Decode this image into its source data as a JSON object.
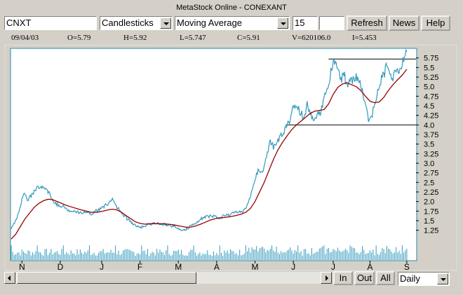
{
  "window": {
    "title": "MetaStock Online - CONEXANT"
  },
  "toolbar": {
    "symbol": "CNXT",
    "chart_style": "Candlesticks",
    "indicator": "Moving Average",
    "period": "15",
    "refresh_label": "Refresh",
    "news_label": "News",
    "help_label": "Help"
  },
  "quote": {
    "date": "09/04/03",
    "open": "O=5.79",
    "high": "H=5.92",
    "low": "L=5.747",
    "close": "C=5.91",
    "volume": "V=620106.0",
    "indicator_value": "I=5.453"
  },
  "bottom": {
    "zoom_in_label": "In",
    "zoom_out_label": "Out",
    "all_label": "All",
    "interval": "Daily"
  },
  "colors": {
    "price": "#3399bb",
    "moving_average": "#990000",
    "volume": "#3399bb",
    "chart_background": "#ffffff",
    "frame": "#2a8aa8"
  },
  "icons": {
    "scroll_left": "scroll-left-arrow-icon",
    "scroll_right": "scroll-right-arrow-icon",
    "dropdown": "chevron-down-icon"
  },
  "chart_data": {
    "type": "line",
    "symbol": "CNXT",
    "interval": "Daily",
    "y_ticks": [
      "5.75",
      "5.5",
      "5.25",
      "5.0",
      "4.75",
      "4.5",
      "4.25",
      "4.0",
      "3.75",
      "3.5",
      "3.25",
      "3.0",
      "2.75",
      "2.5",
      "2.25",
      "2.0",
      "1.75",
      "1.5",
      "1.25"
    ],
    "ylim": [
      0.95,
      6.0
    ],
    "x_ticks": [
      "N",
      "D",
      "J",
      "F",
      "M",
      "A",
      "M",
      "J",
      "J",
      "A",
      "S"
    ],
    "x_tick_positions": [
      7,
      32,
      59,
      84,
      109,
      134,
      159,
      184,
      210,
      234,
      258
    ],
    "xlim": [
      0,
      264
    ],
    "series": [
      {
        "role": "price",
        "points": [
          [
            0,
            1.3
          ],
          [
            3,
            1.5
          ],
          [
            6,
            1.85
          ],
          [
            8,
            2.25
          ],
          [
            11,
            2.05
          ],
          [
            14,
            2.2
          ],
          [
            17,
            2.35
          ],
          [
            19,
            2.42
          ],
          [
            22,
            2.38
          ],
          [
            25,
            2.2
          ],
          [
            28,
            1.95
          ],
          [
            31,
            1.9
          ],
          [
            35,
            1.85
          ],
          [
            38,
            1.75
          ],
          [
            41,
            1.78
          ],
          [
            45,
            1.7
          ],
          [
            48,
            1.72
          ],
          [
            52,
            1.68
          ],
          [
            55,
            1.75
          ],
          [
            58,
            1.8
          ],
          [
            61,
            1.88
          ],
          [
            64,
            1.98
          ],
          [
            66,
            2.08
          ],
          [
            68,
            1.9
          ],
          [
            71,
            1.75
          ],
          [
            74,
            1.62
          ],
          [
            77,
            1.5
          ],
          [
            80,
            1.4
          ],
          [
            83,
            1.32
          ],
          [
            86,
            1.35
          ],
          [
            90,
            1.4
          ],
          [
            94,
            1.44
          ],
          [
            98,
            1.42
          ],
          [
            102,
            1.38
          ],
          [
            106,
            1.36
          ],
          [
            109,
            1.3
          ],
          [
            112,
            1.25
          ],
          [
            115,
            1.3
          ],
          [
            118,
            1.38
          ],
          [
            121,
            1.45
          ],
          [
            124,
            1.55
          ],
          [
            127,
            1.6
          ],
          [
            130,
            1.62
          ],
          [
            133,
            1.6
          ],
          [
            136,
            1.58
          ],
          [
            139,
            1.62
          ],
          [
            142,
            1.65
          ],
          [
            145,
            1.7
          ],
          [
            148,
            1.72
          ],
          [
            151,
            1.75
          ],
          [
            153,
            1.82
          ],
          [
            155,
            2.0
          ],
          [
            157,
            2.3
          ],
          [
            159,
            2.6
          ],
          [
            161,
            2.8
          ],
          [
            163,
            2.75
          ],
          [
            165,
            2.9
          ],
          [
            167,
            3.25
          ],
          [
            169,
            3.55
          ],
          [
            171,
            3.42
          ],
          [
            173,
            3.52
          ],
          [
            175,
            3.65
          ],
          [
            177,
            3.75
          ],
          [
            179,
            3.88
          ],
          [
            181,
            4.05
          ],
          [
            183,
            4.35
          ],
          [
            185,
            4.55
          ],
          [
            187,
            4.45
          ],
          [
            189,
            4.3
          ],
          [
            191,
            4.2
          ],
          [
            193,
            4.55
          ],
          [
            195,
            4.35
          ],
          [
            197,
            4.1
          ],
          [
            199,
            4.25
          ],
          [
            201,
            4.3
          ],
          [
            203,
            4.45
          ],
          [
            205,
            4.85
          ],
          [
            207,
            5.1
          ],
          [
            209,
            5.5
          ],
          [
            211,
            5.62
          ],
          [
            213,
            5.45
          ],
          [
            215,
            5.15
          ],
          [
            217,
            5.35
          ],
          [
            219,
            5.05
          ],
          [
            221,
            5.2
          ],
          [
            223,
            5.15
          ],
          [
            225,
            5.3
          ],
          [
            227,
            5.1
          ],
          [
            229,
            4.95
          ],
          [
            231,
            4.55
          ],
          [
            233,
            4.05
          ],
          [
            235,
            4.15
          ],
          [
            237,
            4.6
          ],
          [
            239,
            4.9
          ],
          [
            241,
            5.15
          ],
          [
            243,
            5.3
          ],
          [
            245,
            5.55
          ],
          [
            247,
            5.4
          ],
          [
            249,
            5.25
          ],
          [
            251,
            5.5
          ],
          [
            253,
            5.45
          ],
          [
            255,
            5.6
          ],
          [
            257,
            5.8
          ],
          [
            258,
            5.91
          ]
        ]
      },
      {
        "role": "moving_average",
        "points": [
          [
            0,
            1.02
          ],
          [
            3,
            1.15
          ],
          [
            6,
            1.35
          ],
          [
            9,
            1.55
          ],
          [
            12,
            1.7
          ],
          [
            15,
            1.85
          ],
          [
            18,
            1.95
          ],
          [
            21,
            2.02
          ],
          [
            24,
            2.06
          ],
          [
            27,
            2.05
          ],
          [
            30,
            2.0
          ],
          [
            33,
            1.95
          ],
          [
            36,
            1.9
          ],
          [
            40,
            1.85
          ],
          [
            44,
            1.8
          ],
          [
            48,
            1.76
          ],
          [
            52,
            1.72
          ],
          [
            56,
            1.72
          ],
          [
            60,
            1.75
          ],
          [
            63,
            1.78
          ],
          [
            66,
            1.8
          ],
          [
            69,
            1.78
          ],
          [
            72,
            1.72
          ],
          [
            75,
            1.63
          ],
          [
            78,
            1.55
          ],
          [
            81,
            1.47
          ],
          [
            84,
            1.43
          ],
          [
            87,
            1.41
          ],
          [
            90,
            1.42
          ],
          [
            94,
            1.42
          ],
          [
            98,
            1.42
          ],
          [
            102,
            1.41
          ],
          [
            106,
            1.39
          ],
          [
            110,
            1.36
          ],
          [
            114,
            1.33
          ],
          [
            117,
            1.33
          ],
          [
            120,
            1.36
          ],
          [
            123,
            1.4
          ],
          [
            126,
            1.45
          ],
          [
            130,
            1.52
          ],
          [
            134,
            1.56
          ],
          [
            138,
            1.58
          ],
          [
            142,
            1.6
          ],
          [
            146,
            1.63
          ],
          [
            150,
            1.67
          ],
          [
            153,
            1.72
          ],
          [
            156,
            1.82
          ],
          [
            159,
            2.0
          ],
          [
            162,
            2.25
          ],
          [
            165,
            2.5
          ],
          [
            168,
            2.8
          ],
          [
            171,
            3.1
          ],
          [
            174,
            3.35
          ],
          [
            177,
            3.55
          ],
          [
            180,
            3.72
          ],
          [
            183,
            3.88
          ],
          [
            186,
            4.0
          ],
          [
            189,
            4.1
          ],
          [
            192,
            4.2
          ],
          [
            195,
            4.3
          ],
          [
            198,
            4.36
          ],
          [
            201,
            4.38
          ],
          [
            204,
            4.4
          ],
          [
            207,
            4.55
          ],
          [
            210,
            4.8
          ],
          [
            213,
            4.98
          ],
          [
            216,
            5.07
          ],
          [
            219,
            5.1
          ],
          [
            222,
            5.05
          ],
          [
            225,
            5.0
          ],
          [
            228,
            4.9
          ],
          [
            231,
            4.75
          ],
          [
            234,
            4.62
          ],
          [
            237,
            4.58
          ],
          [
            240,
            4.6
          ],
          [
            243,
            4.72
          ],
          [
            246,
            4.9
          ],
          [
            249,
            5.05
          ],
          [
            252,
            5.18
          ],
          [
            255,
            5.3
          ],
          [
            258,
            5.453
          ]
        ]
      }
    ],
    "annotations": [
      {
        "kind": "horizontal_line",
        "y": 5.72,
        "x_from": 207,
        "x_to": 264
      },
      {
        "kind": "horizontal_line",
        "y": 4.0,
        "x_from": 179,
        "x_to": 264
      }
    ],
    "volume": {
      "panel": "bottom",
      "units": "relative"
    },
    "grid": false
  }
}
